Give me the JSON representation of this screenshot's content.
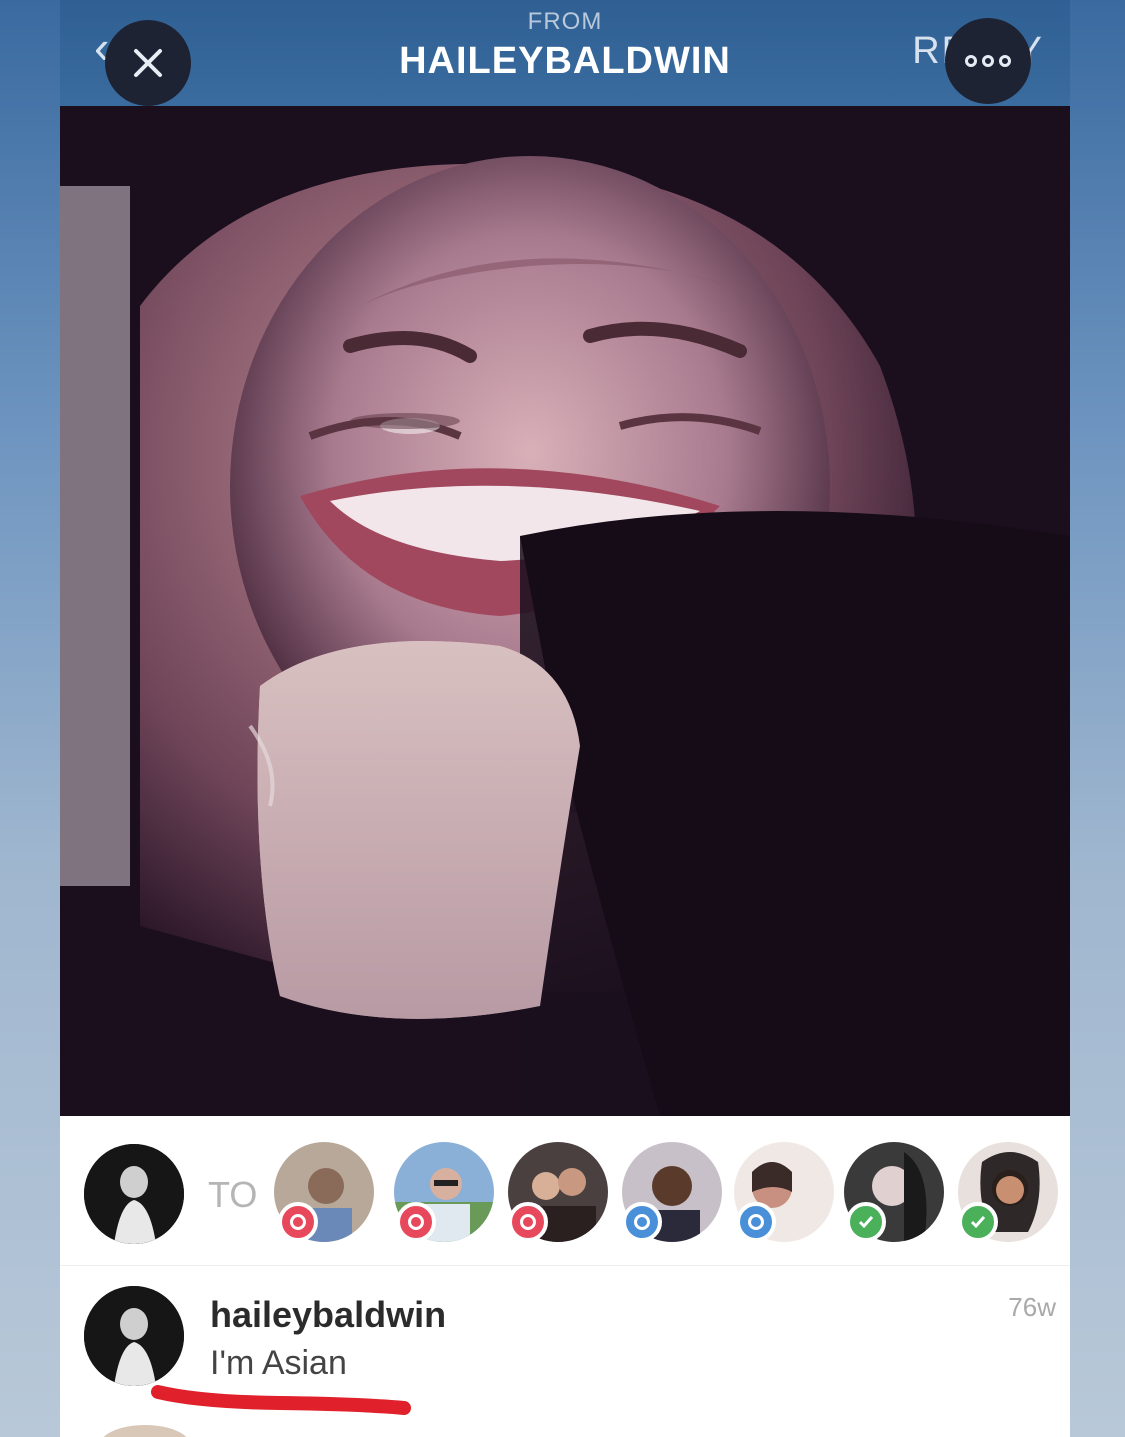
{
  "header": {
    "from_label": "FROM",
    "username": "HAILEYBALDWIN",
    "reply_label": "REPLY",
    "back_icon": "chevron-left-icon",
    "close_icon": "close-icon",
    "more_icon": "more-dots-icon"
  },
  "photo": {
    "subject": "selfie-photo"
  },
  "recipients": {
    "to_label": "TO",
    "items": [
      {
        "status": "heart"
      },
      {
        "status": "heart"
      },
      {
        "status": "heart"
      },
      {
        "status": "seen"
      },
      {
        "status": "seen"
      },
      {
        "status": "check"
      },
      {
        "status": "check"
      }
    ]
  },
  "comment": {
    "username": "haileybaldwin",
    "text": "I'm Asian",
    "time": "76w"
  },
  "colors": {
    "header_bg": "#3a6ca0",
    "heart_badge": "#e8485b",
    "seen_badge": "#4a90d9",
    "check_badge": "#4ab05a",
    "underline": "#e0202a"
  }
}
